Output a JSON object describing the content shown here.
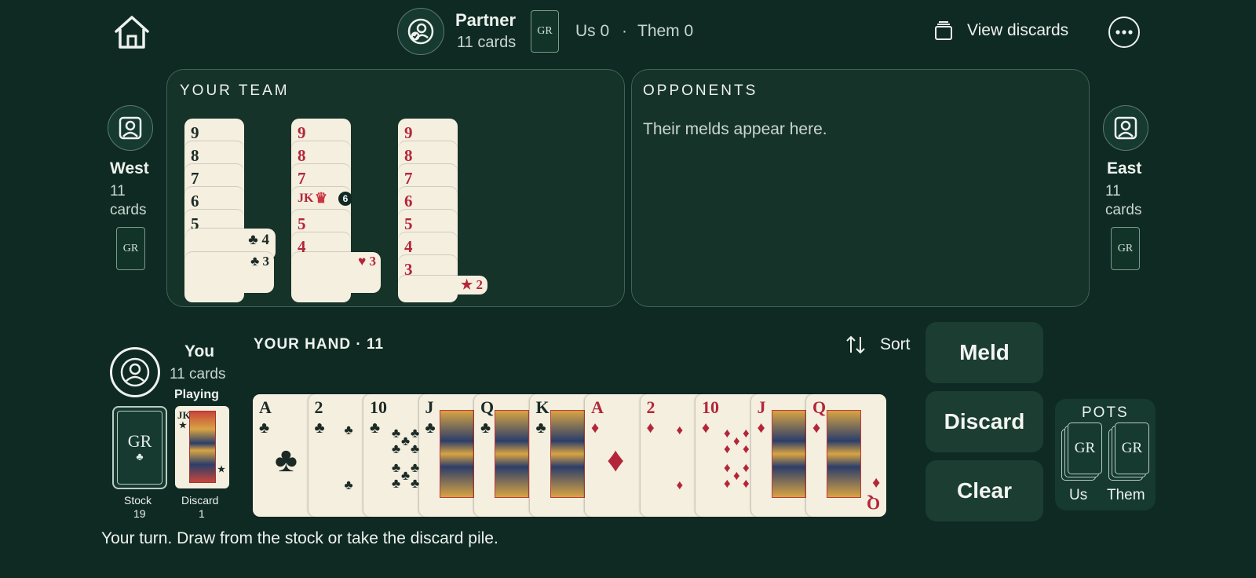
{
  "topbar": {
    "partner_name": "Partner",
    "partner_cards": "11 cards",
    "partner_back": "GR",
    "score_us": "Us 0",
    "score_sep": "·",
    "score_them": "Them 0",
    "view_discards": "View discards"
  },
  "team_panel": {
    "title": "YOUR TEAM",
    "melds": [
      {
        "color": "black",
        "ranks": [
          "9",
          "8",
          "7",
          "6",
          "5",
          "4",
          "3"
        ],
        "top_tail": "4",
        "bottom_tail": "3"
      },
      {
        "color": "red",
        "ranks": [
          "9",
          "8",
          "7",
          "JK",
          "5",
          "4",
          "3"
        ],
        "joker_badge": "6",
        "bottom_tail": "3"
      },
      {
        "color": "red",
        "ranks": [
          "9",
          "8",
          "7",
          "6",
          "5",
          "4",
          "3"
        ],
        "bottom_tail": "2"
      }
    ]
  },
  "opponents_panel": {
    "title": "OPPONENTS",
    "empty_text": "Their melds appear here."
  },
  "west": {
    "name": "West",
    "cards_line1": "11",
    "cards_line2": "cards",
    "back": "GR"
  },
  "east": {
    "name": "East",
    "cards_line1": "11",
    "cards_line2": "cards",
    "back": "GR"
  },
  "you": {
    "name": "You",
    "cards": "11 cards",
    "status": "Playing"
  },
  "stock": {
    "back": "GR",
    "label": "Stock",
    "count": "19"
  },
  "discard": {
    "top": "JK",
    "label": "Discard",
    "count": "1"
  },
  "hand": {
    "title": "YOUR HAND · 11",
    "sort_label": "Sort",
    "cards": [
      {
        "rank": "A",
        "suit": "♣",
        "color": "black"
      },
      {
        "rank": "2",
        "suit": "♣",
        "color": "black"
      },
      {
        "rank": "10",
        "suit": "♣",
        "color": "black"
      },
      {
        "rank": "J",
        "suit": "♣",
        "color": "black"
      },
      {
        "rank": "Q",
        "suit": "♣",
        "color": "black"
      },
      {
        "rank": "K",
        "suit": "♣",
        "color": "black"
      },
      {
        "rank": "A",
        "suit": "♦",
        "color": "red"
      },
      {
        "rank": "2",
        "suit": "♦",
        "color": "red"
      },
      {
        "rank": "10",
        "suit": "♦",
        "color": "red"
      },
      {
        "rank": "J",
        "suit": "♦",
        "color": "red"
      },
      {
        "rank": "Q",
        "suit": "♦",
        "color": "red"
      }
    ]
  },
  "actions": {
    "meld": "Meld",
    "discard": "Discard",
    "clear": "Clear"
  },
  "pots": {
    "title": "POTS",
    "us_label": "Us",
    "them_label": "Them",
    "back": "GR"
  },
  "status_text": "Your turn. Draw from the stock or take the discard pile.",
  "colors": {
    "background": "#0f2a22",
    "panel": "#163329",
    "card_face": "#f5efe0",
    "red_suit": "#b3263a",
    "black_suit": "#1b2a25",
    "button": "#1b3d32"
  }
}
